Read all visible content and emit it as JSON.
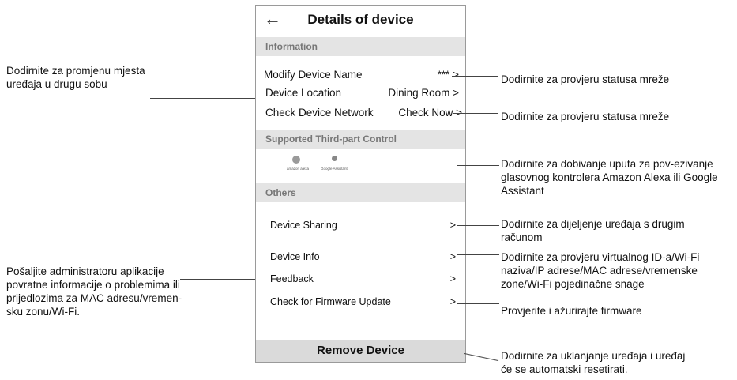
{
  "phone": {
    "title": "Details of device",
    "back_icon": "←",
    "sections": {
      "information": "Information",
      "third_party": "Supported Third-part Control",
      "others": "Others"
    },
    "rows": {
      "modify_name_label": "Modify Device Name",
      "modify_name_value": "*** >",
      "location_label": "Device Location",
      "location_value": "Dining Room >",
      "network_label": "Check Device Network",
      "network_value": "Check Now >",
      "sharing_label": "Device Sharing",
      "info_label": "Device Info",
      "feedback_label": "Feedback",
      "firmware_label": "Check for Firmware Update",
      "chevron": ">"
    },
    "logos": {
      "alexa": "amazon alexa",
      "google": "Google Assistant"
    },
    "remove_button": "Remove Device"
  },
  "annotations": {
    "left_location": "Dodirnite za promjenu mjesta uređaja u drugu sobu",
    "left_feedback": "Pošaljite administratoru aplikacije povratne informacije o problemima ili prijedlozima za MAC adresu/vremen-sku zonu/Wi-Fi.",
    "right_name": "Dodirnite za provjeru statusa mreže",
    "right_network": "Dodirnite za provjeru statusa mreže",
    "right_voice": "Dodirnite za dobivanje uputa za pov-ezivanje glasovnog kontrolera Amazon Alexa ili Google Assistant",
    "right_sharing": "Dodirnite za dijeljenje uređaja s drugim računom",
    "right_info": "Dodirnite za provjeru virtualnog ID-a/Wi-Fi naziva/IP adrese/MAC adrese/vremenske zone/Wi-Fi pojedinačne snage",
    "right_firmware": "Provjerite i ažurirajte firmware",
    "right_remove": "Dodirnite za uklanjanje uređaja i uređaj će se automatski resetirati."
  }
}
